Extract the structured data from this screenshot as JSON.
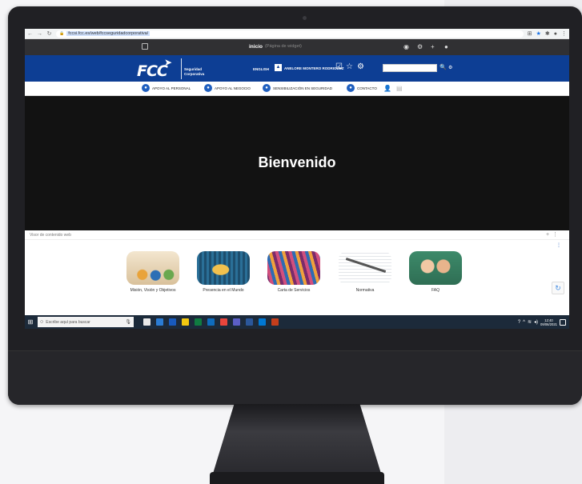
{
  "browser": {
    "url": "fccsi.fcc.es/web/fccseguridadcorporativa/"
  },
  "adminbar": {
    "title": "inicio",
    "subtitle": "(Página de widget)"
  },
  "header": {
    "logo": "FCC",
    "brand_line1": "Seguridad",
    "brand_line2": "Corporativa",
    "language": "ENGLISH",
    "user_name": "ANELORE MONTERO RODRIGUEZ",
    "search_placeholder": ""
  },
  "nav": {
    "items": [
      {
        "label": "APOYO AL PERSONAL"
      },
      {
        "label": "APOYO AL NEGOCIO"
      },
      {
        "label": "SENSIBILIZACIÓN EN SEGURIDAD"
      },
      {
        "label": "CONTACTO"
      }
    ]
  },
  "hero": {
    "title": "Bienvenido"
  },
  "viewer": {
    "title": "Visor de contenido web",
    "tiles": [
      {
        "caption": "Misión, Visión y Objetivos"
      },
      {
        "caption": "Presencia en el Mundo"
      },
      {
        "caption": "Carta de Servicios"
      },
      {
        "caption": "Normativa"
      },
      {
        "caption": "FAQ"
      }
    ]
  },
  "taskbar": {
    "search_placeholder": "Escribe aquí para buscar",
    "time": "12:40",
    "date": "09/06/2021"
  },
  "colors": {
    "header_blue": "#0d3e94",
    "hero_bg": "#121212",
    "taskbar": "#1c2a3a"
  }
}
